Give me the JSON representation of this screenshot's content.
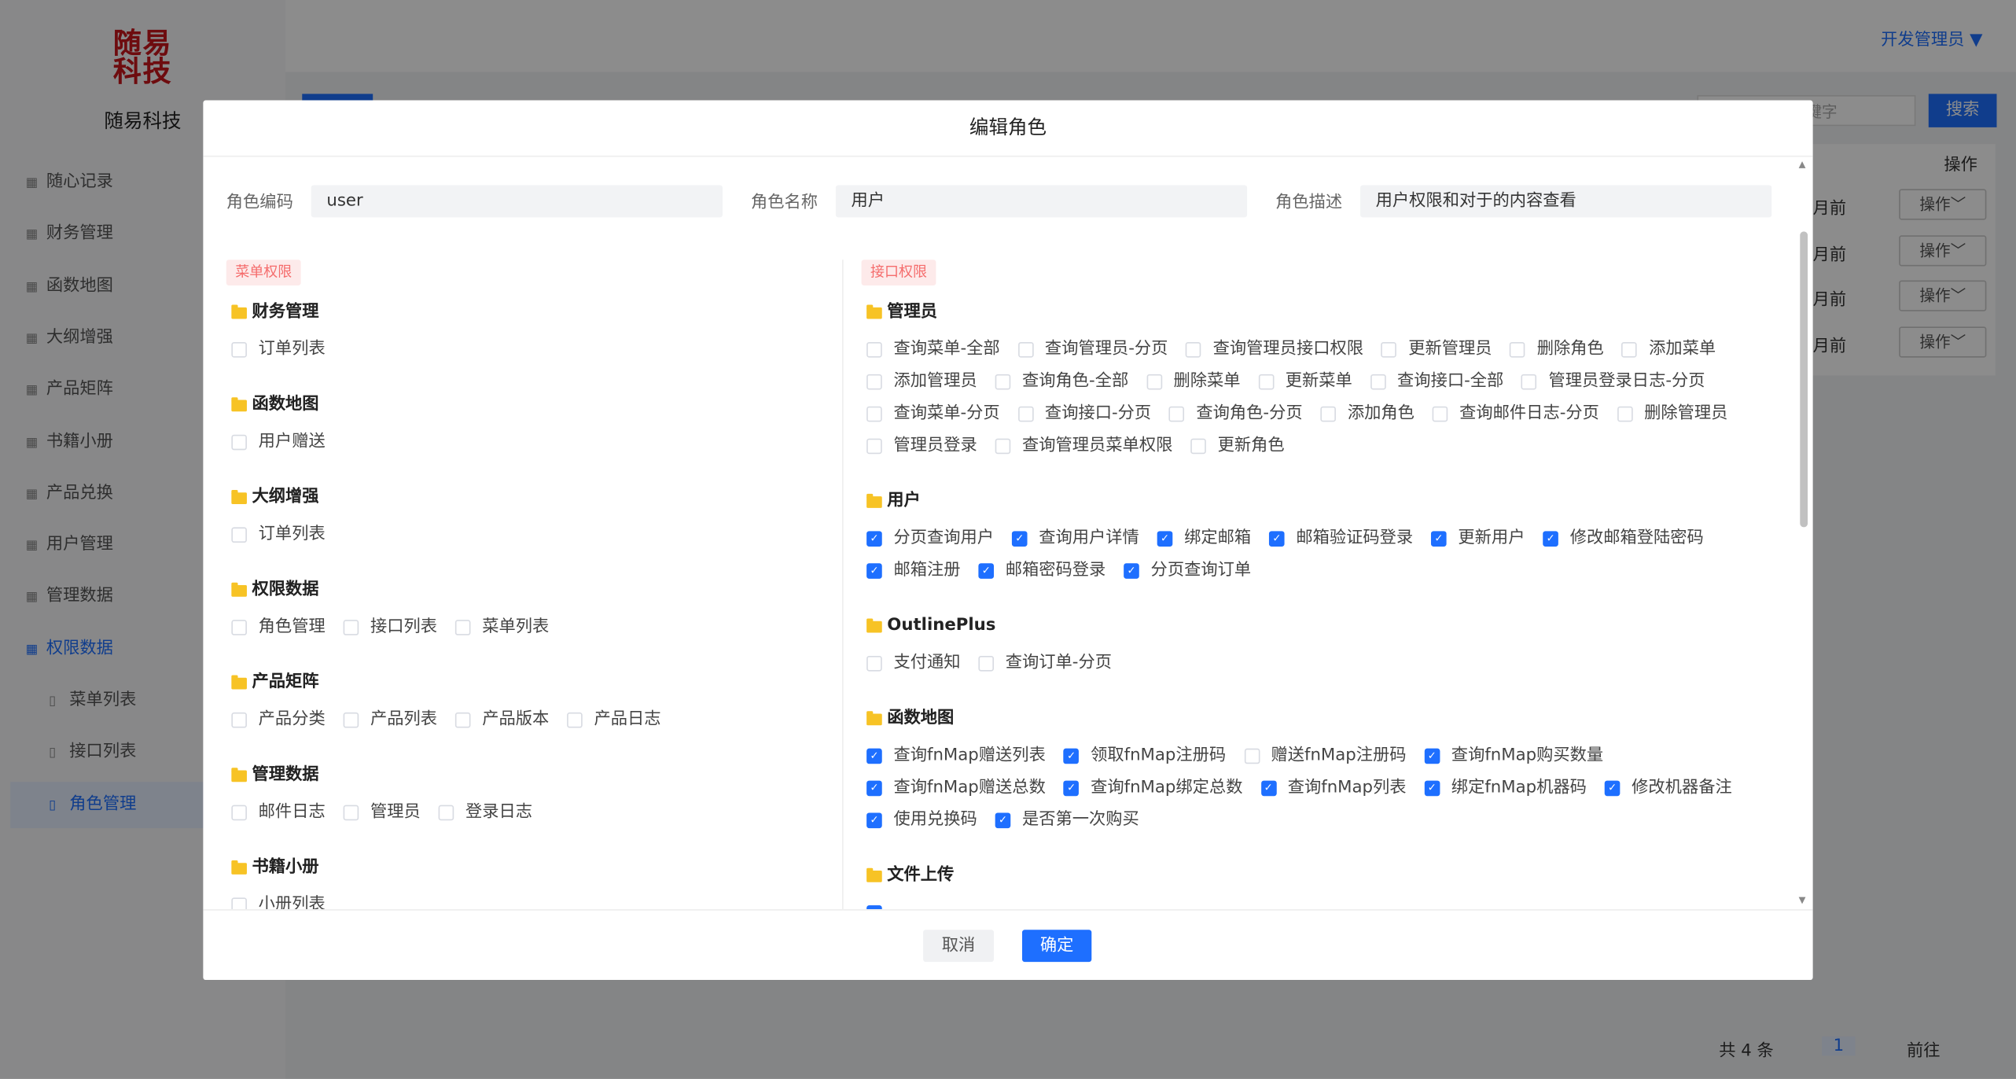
{
  "brand": {
    "logo_text": "随易科技",
    "name": "随易科技",
    "colors": {
      "accent": "#1e6fff",
      "logo": "#c8161d"
    }
  },
  "sidebar": {
    "items": [
      {
        "label": "随心记录",
        "icon": "grid-icon"
      },
      {
        "label": "财务管理",
        "icon": "grid-icon"
      },
      {
        "label": "函数地图",
        "icon": "grid-icon"
      },
      {
        "label": "大纲增强",
        "icon": "grid-icon"
      },
      {
        "label": "产品矩阵",
        "icon": "grid-icon"
      },
      {
        "label": "书籍小册",
        "icon": "grid-icon"
      },
      {
        "label": "产品兑换",
        "icon": "grid-icon"
      },
      {
        "label": "用户管理",
        "icon": "grid-icon"
      },
      {
        "label": "管理数据",
        "icon": "grid-icon"
      },
      {
        "label": "权限数据",
        "icon": "grid-icon",
        "expanded": true
      },
      {
        "label": "菜单列表",
        "icon": "document-icon",
        "sub": true
      },
      {
        "label": "接口列表",
        "icon": "document-icon",
        "sub": true
      },
      {
        "label": "角色管理",
        "icon": "document-icon",
        "sub": true,
        "selected": true
      }
    ]
  },
  "header": {
    "user": "开发管理员 ▼"
  },
  "background": {
    "search_placeholder": "键字",
    "search_button": "搜索",
    "column_op": "操作",
    "rows": [
      {
        "time": "月前",
        "op": "操作﹀"
      },
      {
        "time": "月前",
        "op": "操作﹀"
      },
      {
        "time": "月前",
        "op": "操作﹀"
      },
      {
        "time": "月前",
        "op": "操作﹀"
      }
    ],
    "pagination": {
      "total": "共 4 条",
      "page": "1",
      "goto": "前往"
    }
  },
  "modal": {
    "title": "编辑角色",
    "fields": [
      {
        "label": "角色编码",
        "value": "user"
      },
      {
        "label": "角色名称",
        "value": "用户"
      },
      {
        "label": "角色描述",
        "value": "用户权限和对于的内容查看"
      }
    ],
    "menu_tag": "菜单权限",
    "api_tag": "接口权限",
    "menu_groups": [
      {
        "title": "财务管理",
        "items": [
          {
            "label": "订单列表",
            "checked": false
          }
        ]
      },
      {
        "title": "函数地图",
        "items": [
          {
            "label": "用户赠送",
            "checked": false
          }
        ]
      },
      {
        "title": "大纲增强",
        "items": [
          {
            "label": "订单列表",
            "checked": false
          }
        ]
      },
      {
        "title": "权限数据",
        "items": [
          {
            "label": "角色管理",
            "checked": false
          },
          {
            "label": "接口列表",
            "checked": false
          },
          {
            "label": "菜单列表",
            "checked": false
          }
        ]
      },
      {
        "title": "产品矩阵",
        "items": [
          {
            "label": "产品分类",
            "checked": false
          },
          {
            "label": "产品列表",
            "checked": false
          },
          {
            "label": "产品版本",
            "checked": false
          },
          {
            "label": "产品日志",
            "checked": false
          }
        ]
      },
      {
        "title": "管理数据",
        "items": [
          {
            "label": "邮件日志",
            "checked": false
          },
          {
            "label": "管理员",
            "checked": false
          },
          {
            "label": "登录日志",
            "checked": false
          }
        ]
      },
      {
        "title": "书籍小册",
        "items": [
          {
            "label": "小册列表",
            "checked": false
          }
        ]
      }
    ],
    "api_groups": [
      {
        "title": "管理员",
        "items": [
          {
            "label": "查询菜单-全部",
            "checked": false
          },
          {
            "label": "查询管理员-分页",
            "checked": false
          },
          {
            "label": "查询管理员接口权限",
            "checked": false
          },
          {
            "label": "更新管理员",
            "checked": false
          },
          {
            "label": "删除角色",
            "checked": false
          },
          {
            "label": "添加菜单",
            "checked": false
          },
          {
            "label": "添加管理员",
            "checked": false
          },
          {
            "label": "查询角色-全部",
            "checked": false
          },
          {
            "label": "删除菜单",
            "checked": false
          },
          {
            "label": "更新菜单",
            "checked": false
          },
          {
            "label": "查询接口-全部",
            "checked": false
          },
          {
            "label": "管理员登录日志-分页",
            "checked": false
          },
          {
            "label": "查询菜单-分页",
            "checked": false
          },
          {
            "label": "查询接口-分页",
            "checked": false
          },
          {
            "label": "查询角色-分页",
            "checked": false
          },
          {
            "label": "添加角色",
            "checked": false
          },
          {
            "label": "查询邮件日志-分页",
            "checked": false
          },
          {
            "label": "删除管理员",
            "checked": false
          },
          {
            "label": "管理员登录",
            "checked": false
          },
          {
            "label": "查询管理员菜单权限",
            "checked": false
          },
          {
            "label": "更新角色",
            "checked": false
          }
        ]
      },
      {
        "title": "用户",
        "items": [
          {
            "label": "分页查询用户",
            "checked": true
          },
          {
            "label": "查询用户详情",
            "checked": true
          },
          {
            "label": "绑定邮箱",
            "checked": true
          },
          {
            "label": "邮箱验证码登录",
            "checked": true
          },
          {
            "label": "更新用户",
            "checked": true
          },
          {
            "label": "修改邮箱登陆密码",
            "checked": true
          },
          {
            "label": "邮箱注册",
            "checked": true
          },
          {
            "label": "邮箱密码登录",
            "checked": true
          },
          {
            "label": "分页查询订单",
            "checked": true
          }
        ]
      },
      {
        "title": "OutlinePlus",
        "items": [
          {
            "label": "支付通知",
            "checked": false
          },
          {
            "label": "查询订单-分页",
            "checked": false
          }
        ]
      },
      {
        "title": "函数地图",
        "items": [
          {
            "label": "查询fnMap赠送列表",
            "checked": true
          },
          {
            "label": "领取fnMap注册码",
            "checked": true
          },
          {
            "label": "赠送fnMap注册码",
            "checked": false
          },
          {
            "label": "查询fnMap购买数量",
            "checked": true
          },
          {
            "label": "查询fnMap赠送总数",
            "checked": true
          },
          {
            "label": "查询fnMap绑定总数",
            "checked": true
          },
          {
            "label": "查询fnMap列表",
            "checked": true
          },
          {
            "label": "绑定fnMap机器码",
            "checked": true
          },
          {
            "label": "修改机器备注",
            "checked": true
          },
          {
            "label": "使用兑换码",
            "checked": true
          },
          {
            "label": "是否第一次购买",
            "checked": true
          }
        ]
      },
      {
        "title": "文件上传",
        "items": [
          {
            "label": "",
            "checked": true
          }
        ]
      }
    ],
    "cancel": "取消",
    "confirm": "确定"
  }
}
